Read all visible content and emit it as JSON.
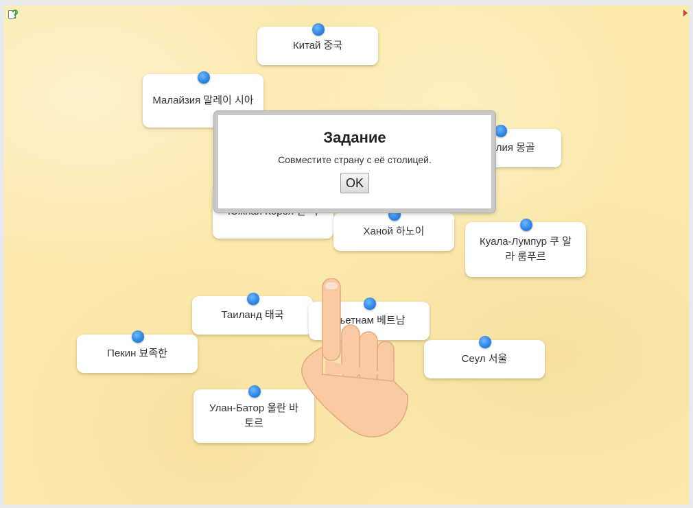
{
  "dialog": {
    "title": "Задание",
    "text": "Совместите страну с её столицей.",
    "ok_label": "OK"
  },
  "cards": [
    {
      "name": "card-china",
      "label": "Китай 중국"
    },
    {
      "name": "card-malaysia",
      "label": "Малайзия 말레이 시아"
    },
    {
      "name": "card-mongolia",
      "label": "Монголия 몽골"
    },
    {
      "name": "card-south-korea",
      "label": "Южная Корея 한 국"
    },
    {
      "name": "card-hanoi",
      "label": "Ханой 하노이"
    },
    {
      "name": "card-kuala-lumpur",
      "label": "Куала-Лумпур 쿠 알라 룸푸르"
    },
    {
      "name": "card-thailand",
      "label": "Таиланд 태국"
    },
    {
      "name": "card-vietnam",
      "label": "Вьетнам 베트남"
    },
    {
      "name": "card-beijing",
      "label": "Пекин 뵤족한"
    },
    {
      "name": "card-seoul",
      "label": "Сеул 서울"
    },
    {
      "name": "card-ulaanbaatar",
      "label": "Улан-Батор 울란 바토르"
    }
  ],
  "icons": {
    "help": "help-icon",
    "hand": "pointing-hand-icon",
    "pin": "pin-icon"
  },
  "colors": {
    "board": "#fbe9ad",
    "pin": "#2f86e6",
    "hand": "#f9c9a4"
  }
}
